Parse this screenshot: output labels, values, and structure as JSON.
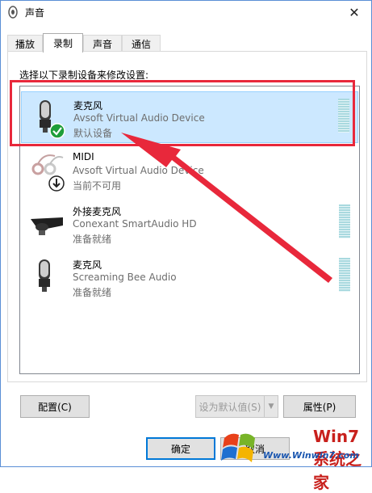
{
  "window": {
    "title": "声音",
    "close_icon": "close-icon"
  },
  "tabs": [
    {
      "label": "播放",
      "active": false
    },
    {
      "label": "录制",
      "active": true
    },
    {
      "label": "声音",
      "active": false
    },
    {
      "label": "通信",
      "active": false
    }
  ],
  "instruction": "选择以下录制设备来修改设置:",
  "devices": [
    {
      "name": "麦克风",
      "driver": "Avsoft Virtual Audio Device",
      "status": "默认设备",
      "icon": "microphone-icon",
      "badge": "green-check-icon",
      "selected": true
    },
    {
      "name": "MIDI",
      "driver": "Avsoft Virtual Audio Device",
      "status": "当前不可用",
      "icon": "audio-cable-icon",
      "badge": "down-arrow-icon",
      "selected": false
    },
    {
      "name": "外接麦克风",
      "driver": "Conexant SmartAudio HD",
      "status": "准备就绪",
      "icon": "external-microphone-icon",
      "selected": false
    },
    {
      "name": "麦克风",
      "driver": "Screaming Bee Audio",
      "status": "准备就绪",
      "icon": "microphone-icon",
      "selected": false
    }
  ],
  "buttons": {
    "configure": "配置(C)",
    "set_default": "设为默认值(S)",
    "properties": "属性(P)",
    "ok": "确定",
    "cancel": "取消"
  },
  "watermark": {
    "brand": "Win7系统之家",
    "url": "Www.Winwin7.com"
  },
  "colors": {
    "annotation_red": "#e8283b",
    "selection": "#cce8ff",
    "accent": "#0078d7"
  }
}
